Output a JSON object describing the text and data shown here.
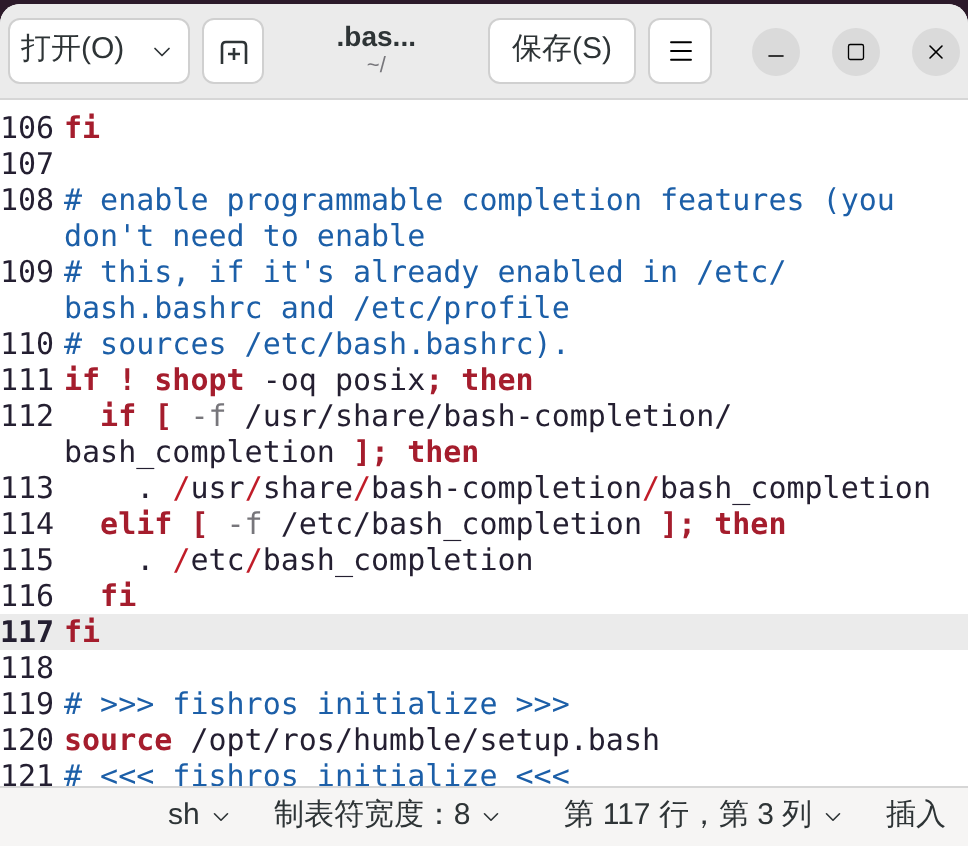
{
  "header": {
    "open_button": {
      "label": "打开(O)"
    },
    "title": ".bas...",
    "subtitle": "~/",
    "save_button": {
      "label": "保存(S)"
    }
  },
  "editor": {
    "lines": [
      {
        "number": "106",
        "current": false,
        "segments": [
          {
            "kind": "keyword",
            "text": "fi"
          }
        ]
      },
      {
        "number": "107",
        "current": false
      },
      {
        "number": "108",
        "current": false,
        "segments": [
          {
            "kind": "comment",
            "text": "# enable programmable completion features (you"
          },
          {
            "kind": "break"
          },
          {
            "kind": "comment",
            "text": "don't need to enable"
          }
        ]
      },
      {
        "number": "109",
        "current": false,
        "segments": [
          {
            "kind": "comment",
            "text": "# this, if it's already enabled in /etc/"
          },
          {
            "kind": "break"
          },
          {
            "kind": "comment",
            "text": "bash.bashrc and /etc/profile"
          }
        ]
      },
      {
        "number": "110",
        "current": false,
        "segments": [
          {
            "kind": "comment",
            "text": "# sources /etc/bash.bashrc)."
          }
        ]
      },
      {
        "number": "111",
        "current": false,
        "segments": [
          {
            "kind": "keyword",
            "text": "if ! shopt"
          },
          {
            "kind": "plain",
            "text": " -oq posix"
          },
          {
            "kind": "keyword",
            "text": "; then"
          }
        ]
      },
      {
        "number": "112",
        "current": false,
        "segments": [
          {
            "kind": "keyword",
            "text": "  if ["
          },
          {
            "kind": "option",
            "text": " -f"
          },
          {
            "kind": "plain",
            "text": " /usr/share/bash-completion/"
          },
          {
            "kind": "break"
          },
          {
            "kind": "plain",
            "text": "bash_completion "
          },
          {
            "kind": "keyword",
            "text": "]; then"
          }
        ]
      },
      {
        "number": "113",
        "current": false,
        "segments": [
          {
            "kind": "plain",
            "text": "    . "
          },
          {
            "kind": "operator",
            "text": "/"
          },
          {
            "kind": "plain",
            "text": "usr"
          },
          {
            "kind": "operator",
            "text": "/"
          },
          {
            "kind": "plain",
            "text": "share"
          },
          {
            "kind": "operator",
            "text": "/"
          },
          {
            "kind": "plain",
            "text": "bash-completion"
          },
          {
            "kind": "operator",
            "text": "/"
          },
          {
            "kind": "plain",
            "text": "bash_completion"
          }
        ]
      },
      {
        "number": "114",
        "current": false,
        "segments": [
          {
            "kind": "keyword",
            "text": "  elif ["
          },
          {
            "kind": "option",
            "text": " -f"
          },
          {
            "kind": "plain",
            "text": " /etc/bash_completion "
          },
          {
            "kind": "keyword",
            "text": "]; then"
          }
        ]
      },
      {
        "number": "115",
        "current": false,
        "segments": [
          {
            "kind": "plain",
            "text": "    . "
          },
          {
            "kind": "operator",
            "text": "/"
          },
          {
            "kind": "plain",
            "text": "etc"
          },
          {
            "kind": "operator",
            "text": "/"
          },
          {
            "kind": "plain",
            "text": "bash_completion"
          }
        ]
      },
      {
        "number": "116",
        "current": false,
        "segments": [
          {
            "kind": "keyword",
            "text": "  fi"
          }
        ]
      },
      {
        "number": "117",
        "current": true,
        "segments": [
          {
            "kind": "keyword",
            "text": "fi"
          }
        ]
      },
      {
        "number": "118",
        "current": false
      },
      {
        "number": "119",
        "current": false,
        "segments": [
          {
            "kind": "comment",
            "text": "# >>> fishros initialize >>>"
          }
        ]
      },
      {
        "number": "120",
        "current": false,
        "segments": [
          {
            "kind": "keyword",
            "text": "source"
          },
          {
            "kind": "plain",
            "text": " /opt/ros/humble/setup.bash"
          }
        ]
      },
      {
        "number": "121",
        "current": false,
        "segments": [
          {
            "kind": "comment",
            "text": "# <<< fishros initialize <<<"
          }
        ]
      }
    ]
  },
  "status_bar": {
    "language": "sh",
    "tab_width": "制表符宽度：8",
    "position": "第 117 行，第 3 列",
    "mode": "插入"
  }
}
